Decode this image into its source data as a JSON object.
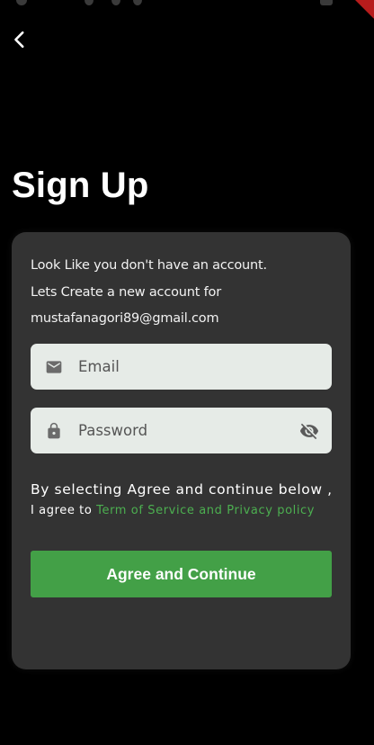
{
  "header": {
    "back_icon": "chevron-left-icon",
    "title": "Sign Up"
  },
  "card": {
    "intro_lines": [
      "Look Like you don't have an account.",
      "Lets Create a new account for",
      "mustafanagori89@gmail.com"
    ],
    "email_field": {
      "label": "Email",
      "value": "",
      "icon": "mail-icon"
    },
    "password_field": {
      "label": "Password",
      "value": "",
      "icon": "lock-icon",
      "toggle_icon": "visibility-off-icon"
    },
    "agreement": {
      "line1": "By selecting Agree and continue below ,",
      "prefix": "I agree to ",
      "link_text": "Term of Service and Privacy policy"
    },
    "submit_label": "Agree and Continue"
  },
  "colors": {
    "background": "#000000",
    "card": "#333333",
    "field": "#e6ebe7",
    "accent": "#43a047",
    "link": "#4caf50"
  }
}
